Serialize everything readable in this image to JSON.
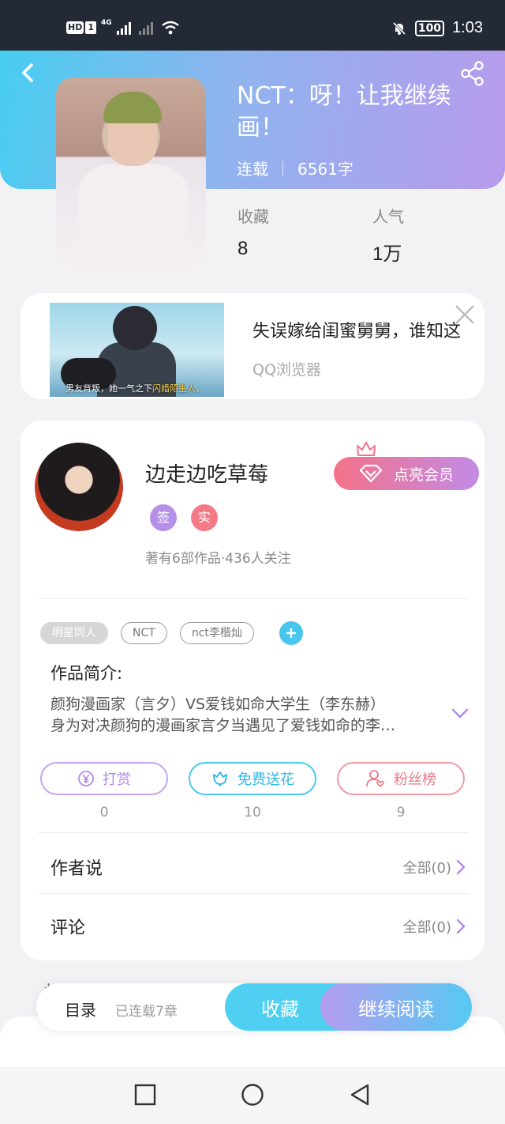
{
  "status_bar": {
    "hd": "HD",
    "sim": "1",
    "network": "4G",
    "battery": "100",
    "time": "1:03"
  },
  "book": {
    "title": "NCT：呀！让我继续画！",
    "status": "连载",
    "word_count": "6561字",
    "stats": [
      {
        "label": "收藏",
        "value": "8"
      },
      {
        "label": "人气",
        "value": "1万"
      }
    ]
  },
  "ad": {
    "caption_pre": "男友背叛，她一气之下",
    "caption_highlight": "闪婚陌生人",
    "caption_post": "，",
    "title": "失误嫁给闺蜜舅舅，谁知这",
    "source": "QQ浏览器"
  },
  "author": {
    "name": "边走边吃草莓",
    "badge_sign": "签",
    "badge_real": "实",
    "meta": "著有6部作品·436人关注",
    "vip_label": "点亮会员"
  },
  "tags": [
    "明星同人",
    "NCT",
    "nct李楷灿"
  ],
  "intro": {
    "label": "作品简介:",
    "line1": "颜狗漫画家（言夕）VS爱钱如命大学生（李东赫）",
    "line2": "身为对决颜狗的漫画家言夕当遇见了爱钱如命的李…"
  },
  "gifts": [
    {
      "label": "打赏",
      "count": "0"
    },
    {
      "label": "免费送花",
      "count": "10"
    },
    {
      "label": "粉丝榜",
      "count": "9"
    }
  ],
  "sections": {
    "author_says": {
      "title": "作者说",
      "link": "全部(0)"
    },
    "comments": {
      "title": "评论",
      "link": "全部(0)"
    }
  },
  "related_peek": "相似作品",
  "bottom_bar": {
    "toc": "目录",
    "toc_sub": "已连载7章",
    "collect": "收藏",
    "continue": "继续阅读"
  },
  "colors": {
    "accent_cyan": "#4fd0f2",
    "accent_purple": "#b89aec",
    "accent_pink": "#f47289"
  },
  "icons": [
    "back-arrow-icon",
    "share-icon",
    "close-icon",
    "crown-icon",
    "diamond-icon",
    "yen-coin-icon",
    "flower-icon",
    "fans-user-icon",
    "chevron-right-icon",
    "chevron-down-icon",
    "plus-icon"
  ]
}
